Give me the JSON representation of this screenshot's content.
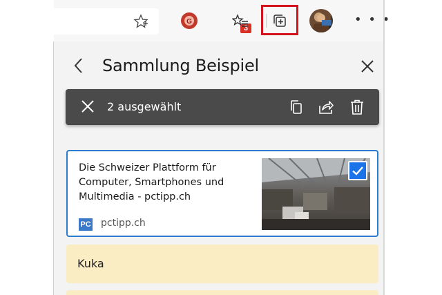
{
  "toolbar": {
    "icons": [
      "favorite-star-icon",
      "extension-icon",
      "favorites-list-icon",
      "collections-icon",
      "profile-avatar",
      "more-icon"
    ],
    "extension_badge": "3",
    "avatar_label": "profile"
  },
  "collection": {
    "title": "Sammlung Beispiel",
    "selection": {
      "count_text": "2 ausgewählt",
      "actions": [
        "copy-icon",
        "share-icon",
        "delete-icon"
      ]
    },
    "items": [
      {
        "type": "page",
        "title": "Die Schweizer Plattform für Computer, Smartphones und Multimedia - pctipp.ch",
        "favicon": "PC",
        "domain": "pctipp.ch",
        "selected": true
      },
      {
        "type": "note",
        "text": "Kuka"
      }
    ]
  },
  "colors": {
    "accent": "#2b7bd0",
    "selection_bar": "#4a4a4a",
    "note": "#fbedc3",
    "highlight": "#d4121e"
  }
}
